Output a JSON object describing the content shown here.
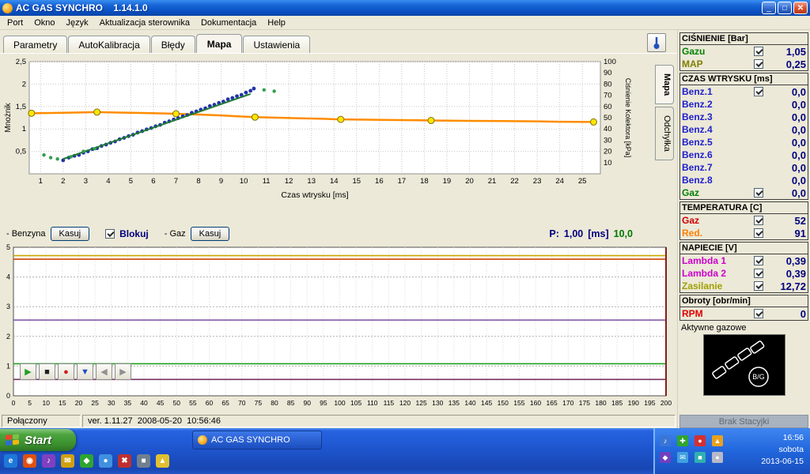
{
  "window": {
    "title": "AC GAS SYNCHRO    1.14.1.0",
    "buttons": {
      "minimize": "_",
      "maximize": "□",
      "close": "✕"
    },
    "menu": [
      "Port",
      "Okno",
      "Język",
      "Aktualizacja sterownika",
      "Dokumentacja",
      "Help"
    ],
    "tabs": [
      "Parametry",
      "AutoKalibracja",
      "Błędy",
      "Mapa",
      "Ustawienia"
    ],
    "active_tab": "Mapa",
    "side_tabs": [
      "Mapa",
      "Odchyłka"
    ]
  },
  "controls": {
    "benzyna_label": "- Benzyna",
    "kasuj_benzyna": "Kasuj",
    "blokuj_label": "Blokuj",
    "blokuj_checked": true,
    "gaz_label": "- Gaz",
    "kasuj_gaz": "Kasuj",
    "p_label": "P:",
    "p_value": "1,00",
    "p_unit": "[ms]",
    "p_secondary": "10,0"
  },
  "chart_data": [
    {
      "type": "scatter",
      "title": "Mapa kalibracji",
      "xlabel": "Czas wtrysku [ms]",
      "ylabel_left": "Mnożnik",
      "ylabel_right": "Ciśnienie Kolektora [kPa]",
      "xlim": [
        0.5,
        25.8
      ],
      "ylim_left": [
        0,
        2.5
      ],
      "ylim_right": [
        0,
        100
      ],
      "x_ticks": [
        1,
        2,
        3,
        4,
        5,
        6,
        7,
        8,
        9,
        10,
        11,
        12,
        13,
        14,
        15,
        16,
        17,
        18,
        19,
        20,
        21,
        22,
        23,
        24,
        25
      ],
      "y_ticks_left": [
        0.5,
        1,
        1.5,
        2,
        2.5
      ],
      "y_ticks_right": [
        10,
        20,
        30,
        40,
        50,
        60,
        70,
        80,
        90,
        100
      ],
      "grid": true,
      "series": [
        {
          "name": "cisnienie-kolektora",
          "type": "line",
          "axis": "right",
          "color": "#FF8C00",
          "width": 2.5,
          "x": [
            0.6,
            1.5,
            2.5,
            3.5,
            4.5,
            5.5,
            6.5,
            7,
            8,
            9,
            10,
            10.5,
            11.5,
            12.5,
            13.5,
            14.3,
            15.5,
            16.5,
            17.5,
            18.3,
            20,
            21.5,
            23,
            24,
            25.5
          ],
          "y": [
            54,
            54.2,
            54.6,
            55,
            54.6,
            54.2,
            53.8,
            53.5,
            52.8,
            52,
            51,
            50.5,
            50,
            49.5,
            49,
            48.5,
            48.2,
            48,
            47.8,
            47.5,
            47.2,
            47,
            46.7,
            46.4,
            46.2
          ],
          "markers_x": [
            0.6,
            3.5,
            7,
            10.5,
            14.3,
            18.3,
            25.5
          ],
          "markers_y": [
            54,
            55,
            53.5,
            50.5,
            48.5,
            47.5,
            46.2
          ],
          "marker_fill": "#FFE600",
          "marker_stroke": "#807000"
        },
        {
          "name": "punkty-benzynowe",
          "type": "scatter",
          "axis": "left",
          "color": "#2233AA",
          "size": 2.4,
          "points": [
            [
              2,
              0.3
            ],
            [
              2.25,
              0.36
            ],
            [
              2.5,
              0.4
            ],
            [
              2.7,
              0.42
            ],
            [
              2.9,
              0.47
            ],
            [
              3.1,
              0.5
            ],
            [
              3.3,
              0.55
            ],
            [
              3.5,
              0.57
            ],
            [
              3.7,
              0.62
            ],
            [
              3.9,
              0.65
            ],
            [
              4.1,
              0.69
            ],
            [
              4.3,
              0.72
            ],
            [
              4.5,
              0.77
            ],
            [
              4.7,
              0.8
            ],
            [
              4.9,
              0.84
            ],
            [
              5.1,
              0.87
            ],
            [
              5.3,
              0.92
            ],
            [
              5.5,
              0.95
            ],
            [
              5.7,
              0.99
            ],
            [
              5.9,
              1.02
            ],
            [
              6.1,
              1.06
            ],
            [
              6.3,
              1.09
            ],
            [
              6.5,
              1.14
            ],
            [
              6.7,
              1.17
            ],
            [
              6.9,
              1.21
            ],
            [
              7.1,
              1.24
            ],
            [
              7.3,
              1.28
            ],
            [
              7.5,
              1.31
            ],
            [
              7.7,
              1.36
            ],
            [
              7.9,
              1.39
            ],
            [
              8.1,
              1.43
            ],
            [
              8.3,
              1.46
            ],
            [
              8.5,
              1.51
            ],
            [
              8.7,
              1.54
            ],
            [
              8.9,
              1.58
            ],
            [
              9.1,
              1.61
            ],
            [
              9.3,
              1.66
            ],
            [
              9.5,
              1.69
            ],
            [
              9.7,
              1.73
            ],
            [
              9.9,
              1.76
            ],
            [
              10.1,
              1.81
            ],
            [
              10.3,
              1.85
            ],
            [
              10.45,
              1.9
            ]
          ]
        },
        {
          "name": "linia-gazowa",
          "type": "line",
          "axis": "left",
          "color": "#1E7A32",
          "width": 2,
          "x": [
            2,
            10.3
          ],
          "y": [
            0.33,
            1.78
          ]
        },
        {
          "name": "punkty-gazowe",
          "type": "scatter",
          "axis": "left",
          "color": "#2FA04A",
          "size": 2.2,
          "points": [
            [
              1.15,
              0.42
            ],
            [
              1.45,
              0.36
            ],
            [
              1.75,
              0.33
            ],
            [
              2.35,
              0.38
            ],
            [
              2.9,
              0.5
            ],
            [
              3.4,
              0.56
            ],
            [
              10.9,
              1.87
            ],
            [
              11.35,
              1.84
            ]
          ]
        }
      ]
    },
    {
      "type": "line",
      "title": "Oscyloskop",
      "xlim": [
        0,
        200
      ],
      "ylim": [
        0,
        5
      ],
      "x_tick_step": 5,
      "y_ticks": [
        0,
        1,
        2,
        3,
        4,
        5
      ],
      "grid": true,
      "threshold_lines": [
        {
          "name": "prog-zolty",
          "color": "#C8A800",
          "y": 4.72
        },
        {
          "name": "prog-czerwony",
          "color": "#CC4400",
          "y": 4.6
        },
        {
          "name": "prog-fioletowy",
          "color": "#7A4FA0",
          "y": 2.55
        },
        {
          "name": "prog-zielony",
          "color": "#1FA01F",
          "y": 1.08
        },
        {
          "name": "prog-bordowy",
          "color": "#7A3060",
          "y": 0.55
        }
      ],
      "cursor_x": 200
    }
  ],
  "scope_controls": [
    {
      "name": "play-button",
      "glyph": "▶",
      "color": "#1F9F1F"
    },
    {
      "name": "stop-button",
      "glyph": "■",
      "color": "#202020"
    },
    {
      "name": "record-button",
      "glyph": "●",
      "color": "#CC2020"
    },
    {
      "name": "marker-button",
      "glyph": "▼",
      "color": "#2050C0"
    },
    {
      "name": "prev-button",
      "glyph": "◀",
      "color": "#909090"
    },
    {
      "name": "next-button",
      "glyph": "▶",
      "color": "#909090"
    }
  ],
  "right_panel": {
    "sections": [
      {
        "title": "CIŚNIENIE [Bar]",
        "rows": [
          {
            "label": "Gazu",
            "color": "#008000",
            "checkbox": true,
            "value": "1,05"
          },
          {
            "label": "MAP",
            "color": "#808000",
            "checkbox": true,
            "value": "0,25"
          }
        ]
      },
      {
        "title": "CZAS WTRYSKU [ms]",
        "rows": [
          {
            "label": "Benz.1",
            "color": "#2020CC",
            "checkbox": true,
            "value": "0,0"
          },
          {
            "label": "Benz.2",
            "color": "#2020CC",
            "checkbox": false,
            "value": "0,0"
          },
          {
            "label": "Benz.3",
            "color": "#2020CC",
            "checkbox": false,
            "value": "0,0"
          },
          {
            "label": "Benz.4",
            "color": "#2020CC",
            "checkbox": false,
            "value": "0,0"
          },
          {
            "label": "Benz.5",
            "color": "#2020CC",
            "checkbox": false,
            "value": "0,0"
          },
          {
            "label": "Benz.6",
            "color": "#2020CC",
            "checkbox": false,
            "value": "0,0"
          },
          {
            "label": "Benz.7",
            "color": "#2020CC",
            "checkbox": false,
            "value": "0,0"
          },
          {
            "label": "Benz.8",
            "color": "#2020CC",
            "checkbox": false,
            "value": "0,0"
          },
          {
            "label": "Gaz",
            "color": "#008000",
            "checkbox": true,
            "value": "0,0"
          }
        ]
      },
      {
        "title": "TEMPERATURA [C]",
        "rows": [
          {
            "label": "Gaz",
            "color": "#D00000",
            "checkbox": true,
            "value": "52"
          },
          {
            "label": "Red.",
            "color": "#FF8000",
            "checkbox": true,
            "value": "91"
          }
        ]
      },
      {
        "title": "NAPIECIE [V]",
        "rows": [
          {
            "label": "Lambda 1",
            "color": "#CC00CC",
            "checkbox": true,
            "value": "0,39"
          },
          {
            "label": "Lambda 2",
            "color": "#CC00CC",
            "checkbox": true,
            "value": "0,39"
          },
          {
            "label": "Zasilanie",
            "color": "#A0A000",
            "checkbox": true,
            "value": "12,72"
          }
        ]
      },
      {
        "title": "Obroty [obr/min]",
        "rows": [
          {
            "label": "RPM",
            "color": "#E00000",
            "checkbox": true,
            "value": "0"
          }
        ]
      }
    ],
    "aktywne_label": "Aktywne gazowe",
    "bg_badge": "B/G",
    "bottom_status": "Brak Stacyjki"
  },
  "statusbar": {
    "connection": "Połączony",
    "version": "ver. 1.11.27  2008-05-20  10:56:46"
  },
  "taskbar": {
    "start_label": "Start",
    "task_button": "AC GAS SYNCHRO",
    "quicklaunch": [
      {
        "name": "quicklaunch-icon-1",
        "glyph": "e",
        "bg": "#1E78D8"
      },
      {
        "name": "quicklaunch-icon-2",
        "glyph": "◉",
        "bg": "#E05010"
      },
      {
        "name": "quicklaunch-icon-3",
        "glyph": "♪",
        "bg": "#8040C0"
      },
      {
        "name": "quicklaunch-icon-4",
        "glyph": "✉",
        "bg": "#D0A010"
      },
      {
        "name": "quicklaunch-icon-5",
        "glyph": "◆",
        "bg": "#2FA52F"
      },
      {
        "name": "quicklaunch-icon-6",
        "glyph": "●",
        "bg": "#4090E0"
      },
      {
        "name": "quicklaunch-icon-7",
        "glyph": "✖",
        "bg": "#C03030"
      },
      {
        "name": "quicklaunch-icon-8",
        "glyph": "■",
        "bg": "#708090"
      },
      {
        "name": "quicklaunch-icon-9",
        "glyph": "▲",
        "bg": "#E0C030"
      }
    ],
    "tray_icons": [
      {
        "name": "tray-volume-icon",
        "glyph": "♪",
        "bg": "#3A76D6"
      },
      {
        "name": "tray-health-icon",
        "glyph": "✚",
        "bg": "#2FA52F"
      },
      {
        "name": "tray-alert-icon",
        "glyph": "●",
        "bg": "#D62F2F"
      },
      {
        "name": "tray-update-icon",
        "glyph": "▲",
        "bg": "#E8A020"
      },
      {
        "name": "tray-app-icon",
        "glyph": "◆",
        "bg": "#7040C0"
      },
      {
        "name": "tray-mail-icon",
        "glyph": "✉",
        "bg": "#40A0E0"
      },
      {
        "name": "tray-display-icon",
        "glyph": "■",
        "bg": "#30B0B0"
      },
      {
        "name": "tray-device-icon",
        "glyph": "●",
        "bg": "#B8B8C8"
      }
    ],
    "clock": {
      "time": "16:56",
      "day": "sobota",
      "date": "2013-06-15"
    }
  },
  "colors": {
    "titlebar_blue": "#0A51C4",
    "taskbar_blue": "#1E55CE",
    "start_green": "#3B8F2E",
    "panel_beige": "#ECE9D8",
    "value_navy": "#00007D",
    "p_green": "#007800",
    "pressure_orange": "#FF8C00",
    "marker_yellow": "#FFE600"
  }
}
